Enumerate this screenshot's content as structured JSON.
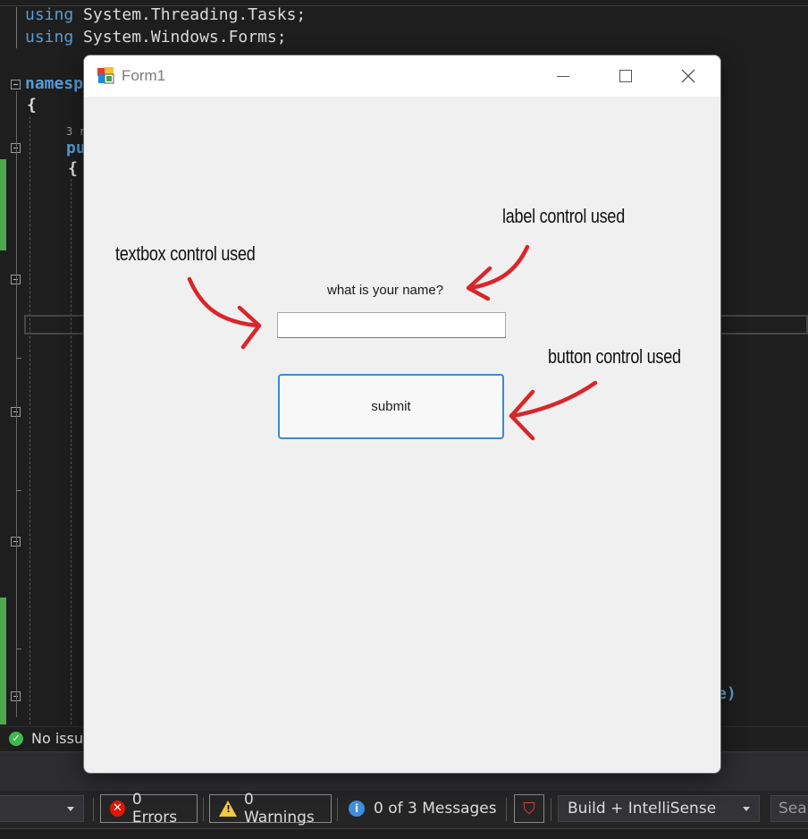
{
  "editor": {
    "line1_kw": "using",
    "line1_rest": " System.Threading.Tasks;",
    "line2_kw": "using",
    "line2_rest": " System.Windows.Forms;",
    "namespace_kw": "namesp",
    "brace_open": "{",
    "refs_hint": "3 r",
    "pu_kw": "pu",
    "inner_brace": "{",
    "tail_text": "e)"
  },
  "status": {
    "text": "No issu"
  },
  "error_list": {
    "errors_label": "0 Errors",
    "warnings_label": "0 Warnings",
    "messages_label": "0 of 3 Messages",
    "build_select": "Build + IntelliSense",
    "search_placeholder": "Sear"
  },
  "form": {
    "title": "Form1",
    "label_text": "what is your name?",
    "textbox_value": "",
    "button_label": "submit"
  },
  "annotations": {
    "label_note": "label control used",
    "textbox_note": "textbox control used",
    "button_note": "button control used"
  },
  "colors": {
    "keyword": "#569cd6",
    "arrow": "#d9262a",
    "button_border": "#3b8ad3",
    "success": "#3fb950"
  }
}
